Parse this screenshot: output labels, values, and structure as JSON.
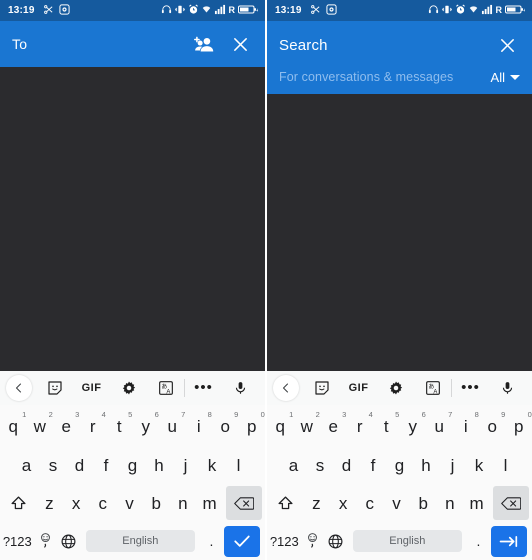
{
  "status_bar": {
    "time": "13:19",
    "left_icons": [
      "scissors-icon",
      "screen-record-icon"
    ],
    "right_icons": [
      "headset-icon",
      "vibrate-icon",
      "alarm-icon",
      "wifi-signal-icon",
      "cellular-signal-icon"
    ],
    "roaming_label": "R",
    "battery_label": "charging-battery-icon",
    "colors": {
      "background": "#155a9e",
      "foreground": "#ffffff"
    }
  },
  "left_panel": {
    "header": {
      "to_label": "To",
      "add_people_icon": "add-person-icon",
      "close_icon": "close-icon",
      "background": "#1a76d2"
    },
    "body": {
      "background": "#2b2b2e"
    }
  },
  "right_panel": {
    "header": {
      "title": "Search",
      "close_icon": "close-icon",
      "subtitle": "For conversations & messages",
      "filter_label": "All",
      "filter_caret": "chevron-down-icon",
      "background": "#1a76d2",
      "subtitle_color": "#8fbdee"
    },
    "body": {
      "background": "#2b2b2e"
    }
  },
  "keyboard": {
    "toolbar": {
      "back_icon": "chevron-left-icon",
      "sticker_icon": "sticker-face-icon",
      "gif_label": "GIF",
      "settings_icon": "gear-icon",
      "translate_icon": "translate-icon",
      "more_icon": "more-dots-icon",
      "mic_icon": "microphone-icon"
    },
    "row1": [
      {
        "letter": "q",
        "number": "1"
      },
      {
        "letter": "w",
        "number": "2"
      },
      {
        "letter": "e",
        "number": "3"
      },
      {
        "letter": "r",
        "number": "4"
      },
      {
        "letter": "t",
        "number": "5"
      },
      {
        "letter": "y",
        "number": "6"
      },
      {
        "letter": "u",
        "number": "7"
      },
      {
        "letter": "i",
        "number": "8"
      },
      {
        "letter": "o",
        "number": "9"
      },
      {
        "letter": "p",
        "number": "0"
      }
    ],
    "row2": [
      "a",
      "s",
      "d",
      "f",
      "g",
      "h",
      "j",
      "k",
      "l"
    ],
    "row3": {
      "shift_icon": "shift-arrow-icon",
      "letters": [
        "z",
        "x",
        "c",
        "v",
        "b",
        "n",
        "m"
      ],
      "backspace_icon": "backspace-icon"
    },
    "row4": {
      "symbols_label": "?123",
      "emoji_icon": "emoji-comma-icon",
      "globe_icon": "language-globe-icon",
      "space_label": "English",
      "period_label": ".",
      "left_action_icon": "check-icon",
      "right_action_icon": "tab-next-icon"
    },
    "colors": {
      "background": "#fafafa",
      "toolbar_background": "#f8f9f9",
      "key_text": "#202124",
      "backspace_background": "#dcdee0",
      "space_background": "#e5e7e9",
      "action_background": "#1a73e8"
    }
  }
}
